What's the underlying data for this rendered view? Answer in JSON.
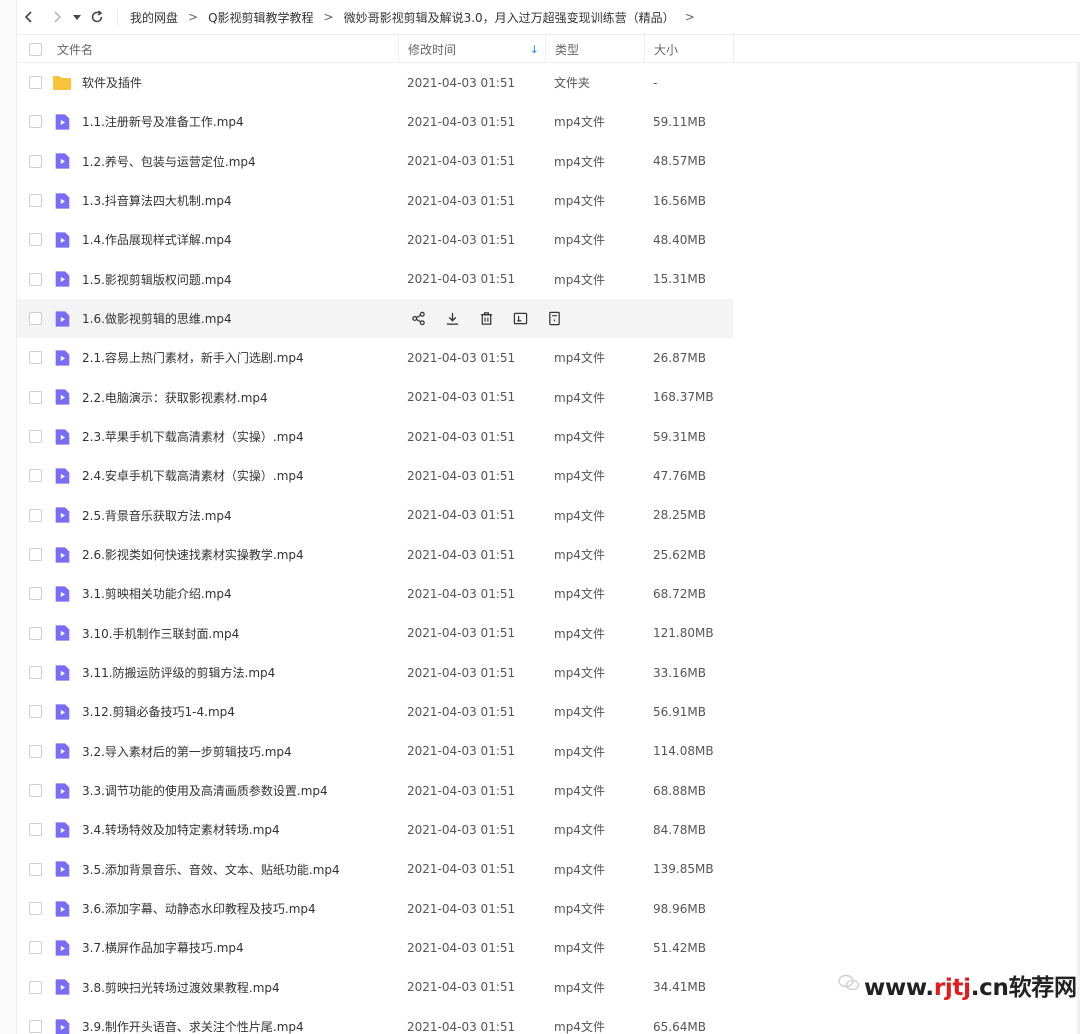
{
  "breadcrumb": {
    "items": [
      "我的网盘",
      "Q影视剪辑教学教程",
      "微妙哥影视剪辑及解说3.0，月入过万超强变现训练营（精品）"
    ],
    "separator": ">"
  },
  "columns": {
    "name": "文件名",
    "modified": "修改时间",
    "type": "类型",
    "size": "大小",
    "sort_indicator": "↓"
  },
  "files": [
    {
      "name": "软件及插件",
      "modified": "2021-04-03 01:51",
      "type": "文件夹",
      "size": "-",
      "icon": "folder-icon"
    },
    {
      "name": "1.1.注册新号及准备工作.mp4",
      "modified": "2021-04-03 01:51",
      "type": "mp4文件",
      "size": "59.11MB",
      "icon": "video-file-icon"
    },
    {
      "name": "1.2.养号、包装与运营定位.mp4",
      "modified": "2021-04-03 01:51",
      "type": "mp4文件",
      "size": "48.57MB",
      "icon": "video-file-icon"
    },
    {
      "name": "1.3.抖音算法四大机制.mp4",
      "modified": "2021-04-03 01:51",
      "type": "mp4文件",
      "size": "16.56MB",
      "icon": "video-file-icon"
    },
    {
      "name": "1.4.作品展现样式详解.mp4",
      "modified": "2021-04-03 01:51",
      "type": "mp4文件",
      "size": "48.40MB",
      "icon": "video-file-icon"
    },
    {
      "name": "1.5.影视剪辑版权问题.mp4",
      "modified": "2021-04-03 01:51",
      "type": "mp4文件",
      "size": "15.31MB",
      "icon": "video-file-icon"
    },
    {
      "name": "1.6.做影视剪辑的思维.mp4",
      "modified": "",
      "type": "",
      "size": "",
      "icon": "video-file-icon",
      "hovered": true
    },
    {
      "name": "2.1.容易上热门素材，新手入门选剧.mp4",
      "modified": "2021-04-03 01:51",
      "type": "mp4文件",
      "size": "26.87MB",
      "icon": "video-file-icon"
    },
    {
      "name": "2.2.电脑演示：获取影视素材.mp4",
      "modified": "2021-04-03 01:51",
      "type": "mp4文件",
      "size": "168.37MB",
      "icon": "video-file-icon"
    },
    {
      "name": "2.3.苹果手机下载高清素材（实操）.mp4",
      "modified": "2021-04-03 01:51",
      "type": "mp4文件",
      "size": "59.31MB",
      "icon": "video-file-icon"
    },
    {
      "name": "2.4.安卓手机下载高清素材（实操）.mp4",
      "modified": "2021-04-03 01:51",
      "type": "mp4文件",
      "size": "47.76MB",
      "icon": "video-file-icon"
    },
    {
      "name": "2.5.背景音乐获取方法.mp4",
      "modified": "2021-04-03 01:51",
      "type": "mp4文件",
      "size": "28.25MB",
      "icon": "video-file-icon"
    },
    {
      "name": "2.6.影视类如何快速找素材实操教学.mp4",
      "modified": "2021-04-03 01:51",
      "type": "mp4文件",
      "size": "25.62MB",
      "icon": "video-file-icon"
    },
    {
      "name": "3.1.剪映相关功能介绍.mp4",
      "modified": "2021-04-03 01:51",
      "type": "mp4文件",
      "size": "68.72MB",
      "icon": "video-file-icon"
    },
    {
      "name": "3.10.手机制作三联封面.mp4",
      "modified": "2021-04-03 01:51",
      "type": "mp4文件",
      "size": "121.80MB",
      "icon": "video-file-icon"
    },
    {
      "name": "3.11.防搬运防评级的剪辑方法.mp4",
      "modified": "2021-04-03 01:51",
      "type": "mp4文件",
      "size": "33.16MB",
      "icon": "video-file-icon"
    },
    {
      "name": "3.12.剪辑必备技巧1-4.mp4",
      "modified": "2021-04-03 01:51",
      "type": "mp4文件",
      "size": "56.91MB",
      "icon": "video-file-icon"
    },
    {
      "name": "3.2.导入素材后的第一步剪辑技巧.mp4",
      "modified": "2021-04-03 01:51",
      "type": "mp4文件",
      "size": "114.08MB",
      "icon": "video-file-icon"
    },
    {
      "name": "3.3.调节功能的使用及高清画质参数设置.mp4",
      "modified": "2021-04-03 01:51",
      "type": "mp4文件",
      "size": "68.88MB",
      "icon": "video-file-icon"
    },
    {
      "name": "3.4.转场特效及加特定素材转场.mp4",
      "modified": "2021-04-03 01:51",
      "type": "mp4文件",
      "size": "84.78MB",
      "icon": "video-file-icon"
    },
    {
      "name": "3.5.添加背景音乐、音效、文本、贴纸功能.mp4",
      "modified": "2021-04-03 01:51",
      "type": "mp4文件",
      "size": "139.85MB",
      "icon": "video-file-icon"
    },
    {
      "name": "3.6.添加字幕、动静态水印教程及技巧.mp4",
      "modified": "2021-04-03 01:51",
      "type": "mp4文件",
      "size": "98.96MB",
      "icon": "video-file-icon"
    },
    {
      "name": "3.7.横屏作品加字幕技巧.mp4",
      "modified": "2021-04-03 01:51",
      "type": "mp4文件",
      "size": "51.42MB",
      "icon": "video-file-icon"
    },
    {
      "name": "3.8.剪映扫光转场过渡效果教程.mp4",
      "modified": "2021-04-03 01:51",
      "type": "mp4文件",
      "size": "34.41MB",
      "icon": "video-file-icon"
    },
    {
      "name": "3.9.制作开头语音、求关注个性片尾.mp4",
      "modified": "2021-04-03 01:51",
      "type": "mp4文件",
      "size": "65.64MB",
      "icon": "video-file-icon"
    }
  ],
  "hover_actions": [
    "share-icon",
    "download-icon",
    "delete-icon",
    "rename-icon",
    "more-icon"
  ],
  "watermark": {
    "prefix": "www.",
    "highlight": "rjtj",
    "suffix": ".cn软荐网"
  },
  "colors": {
    "accent": "#1e88ff",
    "video_icon": "#7b6cf6",
    "folder_icon": "#f9c33c",
    "hover_row": "#f4f4f4",
    "watermark_red": "#e21c1c"
  }
}
